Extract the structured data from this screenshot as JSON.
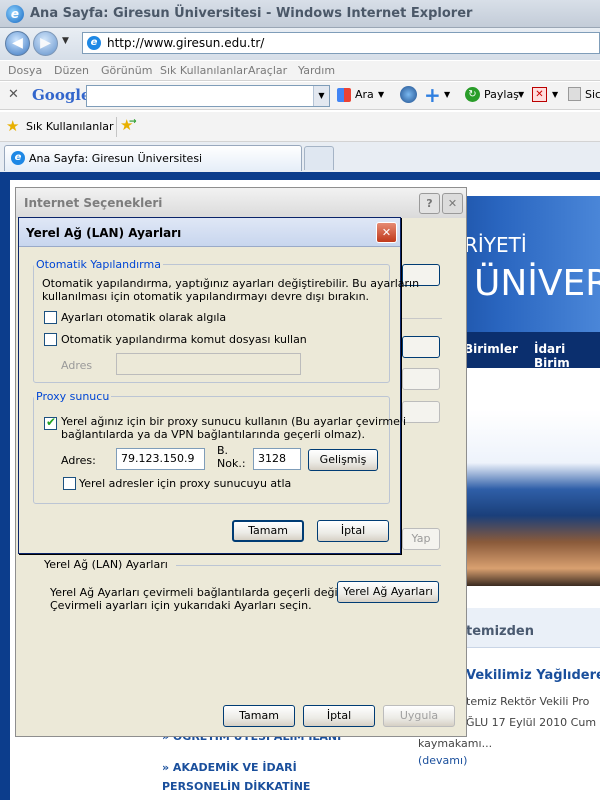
{
  "window": {
    "title": "Ana Sayfa: Giresun Üniversitesi - Windows Internet Explorer"
  },
  "nav": {
    "url": "http://www.giresun.edu.tr/"
  },
  "menu": [
    "Dosya",
    "Düzen",
    "Görünüm",
    "Sık Kullanılanlar",
    "Araçlar",
    "Yardım"
  ],
  "google": {
    "logo": "Google",
    "search_label": "Ara",
    "share_label": "Paylaş",
    "extra_label": "Sic"
  },
  "favbar": {
    "favorites_label": "Sık Kullanılanlar"
  },
  "tab": {
    "label": "Ana Sayfa: Giresun Üniversitesi"
  },
  "site": {
    "banner_top": "RİYETİ",
    "banner_main": "ÜNİVER",
    "nav_items": [
      "Birimler",
      "İdari Birim"
    ],
    "news_heading": "temizden",
    "news_title": "Vekilimiz Yağlıdere",
    "news_line1": "temiz Rektör Vekili Pro",
    "news_line2": "ĞLU 17 Eylül 2010 Cum",
    "news_line3": "kaymakamı...",
    "news_more": "(devamı)",
    "list_item1": "» ÖĞRETİM ÜYESİ ALIM İLANI",
    "list_item2_l1": "» AKADEMİK VE İDARİ",
    "list_item2_l2": "PERSONELİN DİKKATİNE"
  },
  "options_dialog": {
    "title": "Internet Seçenekleri",
    "help_glyph": "?",
    "close_glyph": "✕",
    "hidden_button": "Yap",
    "lan_group_label": "Yerel Ağ (LAN) Ayarları",
    "lan_desc_l1": "Yerel Ağ Ayarları çevirmeli bağlantılarda geçerli değildir.",
    "lan_desc_l2": "Çevirmeli ayarları için yukarıdaki Ayarları seçin.",
    "lan_button": "Yerel Ağ Ayarları",
    "ok": "Tamam",
    "cancel": "İptal",
    "apply": "Uygula"
  },
  "lan_dialog": {
    "title": "Yerel Ağ (LAN) Ayarları",
    "close_glyph": "✕",
    "auto": {
      "legend": "Otomatik Yapılandırma",
      "desc_l1": "Otomatik yapılandırma, yaptığınız ayarları değiştirebilir. Bu ayarların",
      "desc_l2": "kullanılması için otomatik yapılandırmayı devre dışı bırakın.",
      "detect_label": "Ayarları otomatik olarak algıla",
      "script_label": "Otomatik yapılandırma komut dosyası kullan",
      "address_label": "Adres",
      "address_value": ""
    },
    "proxy": {
      "legend": "Proxy sunucu",
      "use_label_l1": "Yerel ağınız için bir proxy sunucu kullanın (Bu ayarlar çevirmeli",
      "use_label_l2": "bağlantılarda ya da VPN bağlantılarında geçerli olmaz).",
      "use_checked": true,
      "address_label": "Adres:",
      "address_value": "79.123.150.9",
      "port_label_l1": "B.",
      "port_label_l2": "Nok.:",
      "port_value": "3128",
      "advanced": "Gelişmiş",
      "bypass_label": "Yerel adresler için proxy sunucuyu atla"
    },
    "ok": "Tamam",
    "cancel": "İptal"
  }
}
